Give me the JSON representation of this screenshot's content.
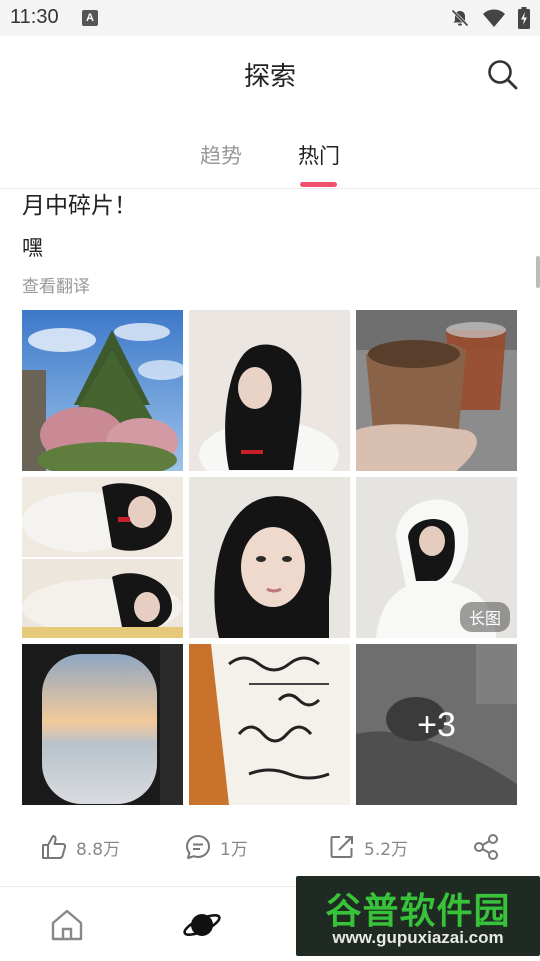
{
  "status_bar": {
    "time": "11:30",
    "app_icon": "A",
    "icons": [
      "notifications-off-icon",
      "wifi-icon",
      "battery-charging-icon"
    ]
  },
  "header": {
    "title": "探索",
    "search_icon": "search-icon"
  },
  "tabs": [
    {
      "label": "趋势",
      "active": false
    },
    {
      "label": "热门",
      "active": true
    }
  ],
  "post": {
    "title": "月中碎片！",
    "text": "嘿",
    "translate": "查看翻译",
    "photos": [
      {
        "subject": "tree-and-blossoms",
        "badge": "",
        "more": ""
      },
      {
        "subject": "portrait-white-hoodie",
        "badge": "",
        "more": ""
      },
      {
        "subject": "coffee-cup",
        "badge": "",
        "more": ""
      },
      {
        "subject": "selfie-lying-down",
        "badge": "",
        "more": ""
      },
      {
        "subject": "close-up-portrait",
        "badge": "",
        "more": ""
      },
      {
        "subject": "hooded-sitting",
        "badge": "长图",
        "more": ""
      },
      {
        "subject": "airplane-window-sunset",
        "badge": "",
        "more": ""
      },
      {
        "subject": "signed-book",
        "badge": "",
        "more": ""
      },
      {
        "subject": "shoes-in-car",
        "badge": "",
        "more": "+3"
      }
    ],
    "actions": {
      "likes": "8.8万",
      "comments": "1万",
      "shares": "5.2万",
      "share_icon": "share-nodes-icon"
    }
  },
  "bottom_nav": [
    {
      "icon": "home-icon",
      "active": false
    },
    {
      "icon": "planet-icon",
      "active": true
    }
  ],
  "watermark": {
    "title": "谷普软件园",
    "url": "www.gupuxiazai.com"
  },
  "colors": {
    "accent": "#f0506e",
    "muted": "#999999",
    "text": "#222222",
    "watermark_green": "#37c23a"
  }
}
